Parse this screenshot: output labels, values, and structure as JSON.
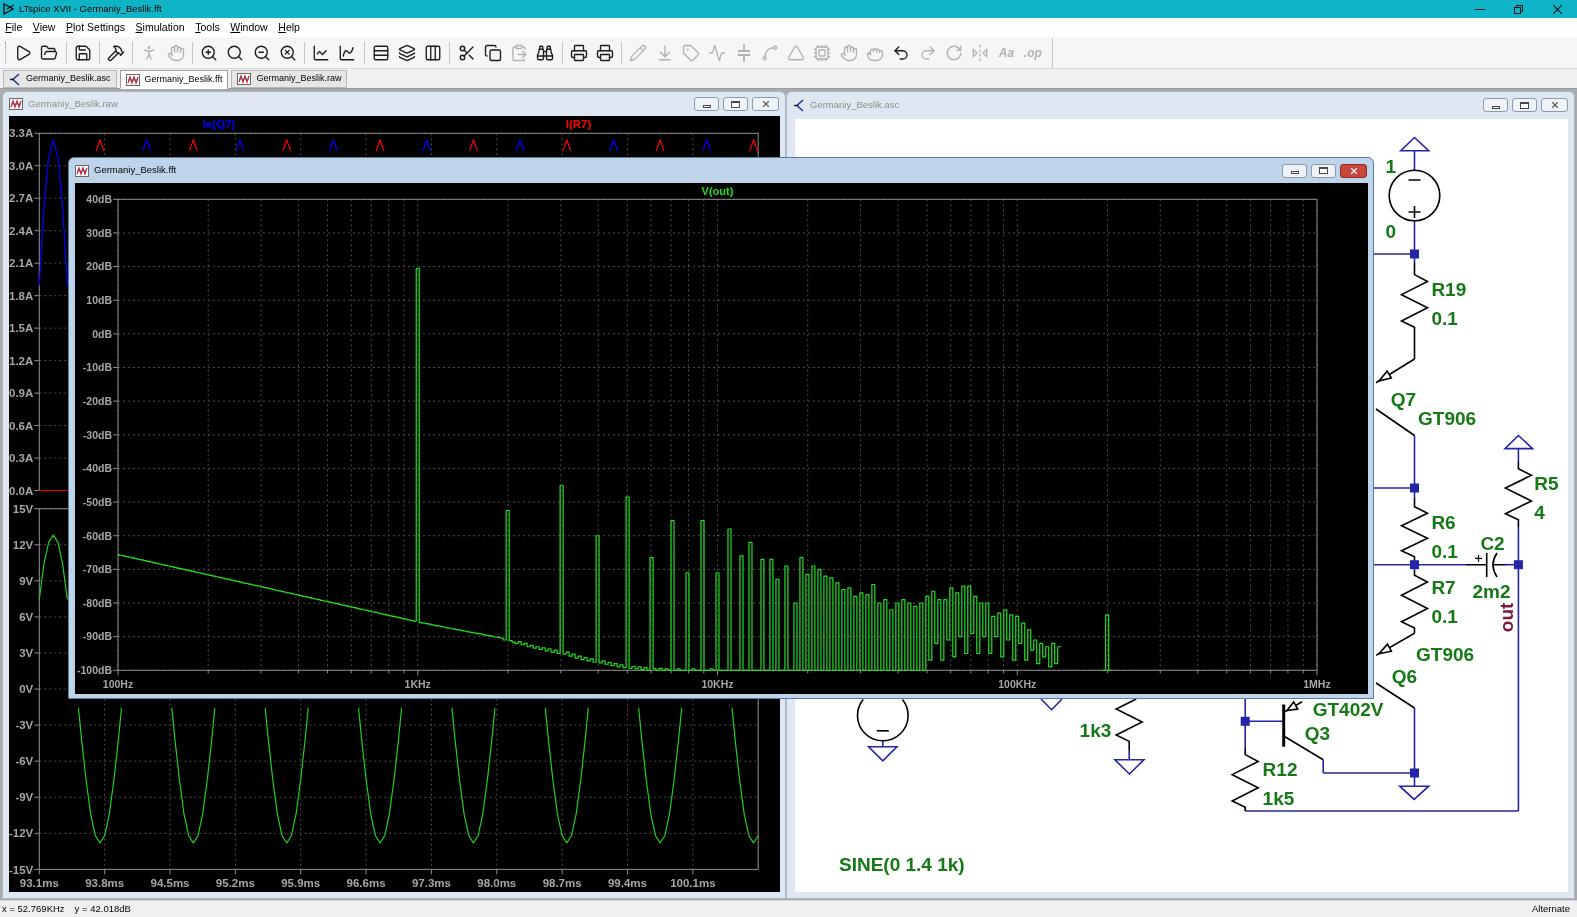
{
  "app": {
    "title": "LTspice XVII - Germaniy_Beslik.fft"
  },
  "menu": [
    "File",
    "View",
    "Plot Settings",
    "Simulation",
    "Tools",
    "Window",
    "Help"
  ],
  "toolbar": {
    "groups": [
      [
        {
          "disabled": false
        },
        {
          "disabled": false
        }
      ],
      [
        {
          "disabled": false
        }
      ],
      [
        {
          "disabled": false
        }
      ],
      [
        {
          "disabled": true
        },
        {
          "disabled": true
        }
      ],
      [
        {
          "disabled": false
        },
        {
          "disabled": false
        },
        {
          "disabled": false
        },
        {
          "disabled": false
        }
      ],
      [
        {
          "disabled": false
        },
        {
          "disabled": false
        }
      ],
      [
        {
          "disabled": false
        },
        {
          "disabled": false
        },
        {
          "disabled": false
        }
      ],
      [
        {
          "disabled": false
        },
        {
          "disabled": false
        },
        {
          "disabled": true
        },
        {
          "disabled": false
        }
      ],
      [
        {
          "disabled": false
        },
        {
          "disabled": false
        }
      ],
      [
        {
          "disabled": true
        },
        {
          "disabled": true
        },
        {
          "disabled": true
        },
        {
          "disabled": true
        },
        {
          "disabled": true
        },
        {
          "disabled": true
        },
        {
          "disabled": true
        },
        {
          "disabled": true
        },
        {
          "disabled": true
        },
        {
          "disabled": true
        },
        {
          "disabled": false
        },
        {
          "disabled": true
        },
        {
          "disabled": true
        },
        {
          "disabled": true
        },
        {
          "disabled": true,
          "label": "Aa"
        },
        {
          "disabled": true,
          "label": ".op"
        }
      ]
    ]
  },
  "tabs": [
    {
      "label": "Germaniy_Beslik.asc",
      "kind": "schematic",
      "selected": false
    },
    {
      "label": "Germaniy_Beslik.fft",
      "kind": "waveform",
      "selected": true
    },
    {
      "label": "Germaniy_Beslik.raw",
      "kind": "waveform",
      "selected": false
    }
  ],
  "raw_window": {
    "title": "Germaniy_Beslik.raw",
    "active": false,
    "panes": [
      {
        "chart_data": {
          "type": "line",
          "grid": true,
          "x": [
            93.1,
            93.15,
            93.2,
            93.25,
            93.3,
            93.35,
            93.4,
            93.5,
            93.71,
            93.75,
            93.79,
            94.0,
            94.21,
            94.25,
            94.29,
            94.5,
            94.71,
            94.75,
            94.79,
            95.0,
            95.21,
            95.25,
            95.29,
            95.5,
            95.71,
            95.75,
            95.79,
            96.0,
            96.21,
            96.25,
            96.29,
            96.5,
            96.71,
            96.75,
            96.79,
            97.0,
            97.21,
            97.25,
            97.29,
            97.5,
            97.71,
            97.75,
            97.79,
            98.0,
            98.21,
            98.25,
            98.29,
            98.5,
            98.71,
            98.75,
            98.79,
            99.0,
            99.21,
            99.25,
            99.29,
            99.5,
            99.71,
            99.75,
            99.79,
            100.0,
            100.21,
            100.25,
            100.29,
            100.5,
            100.71,
            100.75,
            100.79
          ],
          "xlim": [
            93.1,
            100.8
          ],
          "ylim": [
            0,
            3.3
          ],
          "yticks": [
            {
              "value": 0,
              "label": "0.0A"
            },
            {
              "value": 0.3,
              "label": "0.3A"
            },
            {
              "value": 0.6,
              "label": "0.6A"
            },
            {
              "value": 0.9,
              "label": "0.9A"
            },
            {
              "value": 1.2,
              "label": "1.2A"
            },
            {
              "value": 1.5,
              "label": "1.5A"
            },
            {
              "value": 1.8,
              "label": "1.8A"
            },
            {
              "value": 2.1,
              "label": "2.1A"
            },
            {
              "value": 2.4,
              "label": "2.4A"
            },
            {
              "value": 2.7,
              "label": "2.7A"
            },
            {
              "value": 3.0,
              "label": "3.0A"
            },
            {
              "value": 3.3,
              "label": "3.3A"
            }
          ],
          "series": [
            {
              "name": "Ie(Q7)",
              "color": "#0000ff",
              "values": [
                1.9,
                2.62,
                3.08,
                3.24,
                3.08,
                2.62,
                1.9,
                null,
                null,
                null,
                null,
                null,
                3.14,
                3.24,
                3.14,
                null,
                null,
                null,
                null,
                null,
                3.14,
                3.24,
                3.14,
                null,
                null,
                null,
                null,
                null,
                3.14,
                3.24,
                3.14,
                null,
                null,
                null,
                null,
                null,
                3.14,
                3.24,
                3.14,
                null,
                null,
                null,
                null,
                null,
                3.14,
                3.24,
                3.14,
                null,
                null,
                null,
                null,
                null,
                3.14,
                3.24,
                3.14,
                null,
                null,
                null,
                null,
                null,
                3.14,
                3.24,
                3.14,
                null,
                null,
                null,
                null
              ]
            },
            {
              "name": "I(R7)",
              "color": "#ff0000",
              "values": [
                0,
                0,
                0,
                0,
                0,
                0,
                0,
                null,
                3.14,
                3.24,
                3.14,
                null,
                null,
                null,
                null,
                null,
                3.14,
                3.24,
                3.14,
                null,
                null,
                null,
                null,
                null,
                3.14,
                3.24,
                3.14,
                null,
                null,
                null,
                null,
                null,
                3.14,
                3.24,
                3.14,
                null,
                null,
                null,
                null,
                null,
                3.14,
                3.24,
                3.14,
                null,
                null,
                null,
                null,
                null,
                3.14,
                3.24,
                3.14,
                null,
                null,
                null,
                null,
                null,
                3.14,
                3.24,
                3.14,
                null,
                null,
                null,
                null,
                null,
                3.14,
                3.24,
                3.14
              ]
            }
          ]
        }
      },
      {
        "chart_data": {
          "type": "line",
          "grid": true,
          "x": [
            93.1,
            93.15,
            93.2,
            93.25,
            93.3,
            93.35,
            93.4,
            93.46,
            93.52,
            93.55,
            93.6,
            93.65,
            93.7,
            93.75,
            93.8,
            93.85,
            93.9,
            93.95,
            93.98,
            94.4,
            94.52,
            94.55,
            94.6,
            94.65,
            94.7,
            94.75,
            94.8,
            94.85,
            94.9,
            94.95,
            94.98,
            95.4,
            95.52,
            95.55,
            95.6,
            95.65,
            95.7,
            95.75,
            95.8,
            95.85,
            95.9,
            95.95,
            95.98,
            96.4,
            96.52,
            96.55,
            96.6,
            96.65,
            96.7,
            96.75,
            96.8,
            96.85,
            96.9,
            96.95,
            96.98,
            97.4,
            97.52,
            97.55,
            97.6,
            97.65,
            97.7,
            97.75,
            97.8,
            97.85,
            97.9,
            97.95,
            97.98,
            98.4,
            98.52,
            98.55,
            98.6,
            98.65,
            98.7,
            98.75,
            98.8,
            98.85,
            98.9,
            98.95,
            98.98,
            99.4,
            99.52,
            99.55,
            99.6,
            99.65,
            99.7,
            99.75,
            99.8,
            99.85,
            99.9,
            99.95,
            99.98,
            100.4,
            100.52,
            100.55,
            100.6,
            100.65,
            100.7,
            100.75,
            100.8
          ],
          "xlim": [
            93.1,
            100.8
          ],
          "ylim": [
            -15,
            15
          ],
          "xticks": [
            {
              "value": 93.1,
              "label": "93.1ms"
            },
            {
              "value": 93.8,
              "label": "93.8ms"
            },
            {
              "value": 94.5,
              "label": "94.5ms"
            },
            {
              "value": 95.2,
              "label": "95.2ms"
            },
            {
              "value": 95.9,
              "label": "95.9ms"
            },
            {
              "value": 96.6,
              "label": "96.6ms"
            },
            {
              "value": 97.3,
              "label": "97.3ms"
            },
            {
              "value": 98.0,
              "label": "98.0ms"
            },
            {
              "value": 98.7,
              "label": "98.7ms"
            },
            {
              "value": 99.4,
              "label": "99.4ms"
            },
            {
              "value": 100.1,
              "label": "100.1ms"
            }
          ],
          "yticks": [
            {
              "value": -15,
              "label": "-15V"
            },
            {
              "value": -12,
              "label": "-12V"
            },
            {
              "value": -9,
              "label": "-9V"
            },
            {
              "value": -6,
              "label": "-6V"
            },
            {
              "value": -3,
              "label": "-3V"
            },
            {
              "value": 0,
              "label": "0V"
            },
            {
              "value": 3,
              "label": "3V"
            },
            {
              "value": 6,
              "label": "6V"
            },
            {
              "value": 9,
              "label": "9V"
            },
            {
              "value": 12,
              "label": "12V"
            },
            {
              "value": 15,
              "label": "15V"
            }
          ],
          "series": [
            {
              "color": "#22cc22",
              "values": [
                7.5,
                10.4,
                12.2,
                12.8,
                12.2,
                10.4,
                7.5,
                null,
                -1.6,
                -4,
                -7.5,
                -10.4,
                -12.2,
                -12.8,
                -12.2,
                -10.4,
                -7.5,
                -4,
                -1.6,
                null,
                -1.6,
                -4,
                -7.5,
                -10.4,
                -12.2,
                -12.8,
                -12.2,
                -10.4,
                -7.5,
                -4,
                -1.6,
                null,
                -1.6,
                -4,
                -7.5,
                -10.4,
                -12.2,
                -12.8,
                -12.2,
                -10.4,
                -7.5,
                -4,
                -1.6,
                null,
                -1.6,
                -4,
                -7.5,
                -10.4,
                -12.2,
                -12.8,
                -12.2,
                -10.4,
                -7.5,
                -4,
                -1.6,
                null,
                -1.6,
                -4,
                -7.5,
                -10.4,
                -12.2,
                -12.8,
                -12.2,
                -10.4,
                -7.5,
                -4,
                -1.6,
                null,
                -1.6,
                -4,
                -7.5,
                -10.4,
                -12.2,
                -12.8,
                -12.2,
                -10.4,
                -7.5,
                -4,
                -1.6,
                null,
                -1.6,
                -4,
                -7.5,
                -10.4,
                -12.2,
                -12.8,
                -12.2,
                -10.4,
                -7.5,
                -4,
                -1.6,
                null,
                -1.6,
                -4,
                -7.5,
                -10.4,
                -12.2,
                -12.8,
                -12.2
              ]
            }
          ]
        }
      }
    ]
  },
  "schematic_window": {
    "title": "Germaniy_Beslik.asc",
    "active": false,
    "labels": [
      {
        "text": "1",
        "kind": "part"
      },
      {
        "text": "0",
        "kind": "part"
      },
      {
        "text": "R19",
        "kind": "part"
      },
      {
        "text": "0.1",
        "kind": "part"
      },
      {
        "text": "Q7",
        "kind": "part"
      },
      {
        "text": "GT906",
        "kind": "part"
      },
      {
        "text": "R5",
        "kind": "part"
      },
      {
        "text": "4",
        "kind": "part"
      },
      {
        "text": "R6",
        "kind": "part"
      },
      {
        "text": "C2",
        "kind": "part"
      },
      {
        "text": "0.1",
        "kind": "part"
      },
      {
        "text": "R7",
        "kind": "part"
      },
      {
        "text": "2m2",
        "kind": "part"
      },
      {
        "text": "out",
        "kind": "net"
      },
      {
        "text": "0.1",
        "kind": "part"
      },
      {
        "text": "GT906",
        "kind": "part"
      },
      {
        "text": "Q6",
        "kind": "part"
      },
      {
        "text": "GT402V",
        "kind": "part"
      },
      {
        "text": "1k3",
        "kind": "part"
      },
      {
        "text": "Q3",
        "kind": "part"
      },
      {
        "text": "R12",
        "kind": "part"
      },
      {
        "text": "1k5",
        "kind": "part"
      },
      {
        "text": "SINE(0 1.4 1k)",
        "kind": "part"
      }
    ]
  },
  "fft_window": {
    "title": "Germaniy_Beslik.fft",
    "active": true,
    "chart_data": {
      "type": "line",
      "grid": true,
      "categories": [
        "100Hz",
        null,
        null,
        null,
        null,
        null,
        null,
        null,
        null,
        null,
        null,
        null,
        null,
        null,
        null,
        null,
        null,
        null,
        null,
        null,
        null,
        null,
        null,
        null,
        null,
        null,
        null,
        null,
        null,
        null,
        null,
        null,
        null,
        null,
        null,
        null,
        null,
        null,
        null,
        null,
        null,
        null,
        null,
        null,
        null,
        null,
        null,
        null,
        null,
        null,
        null,
        null,
        null,
        null,
        null,
        null,
        null,
        null,
        null,
        null,
        null,
        null,
        null,
        null,
        null,
        null,
        null,
        null,
        null,
        null,
        null,
        null,
        null,
        null,
        null,
        null,
        null,
        null,
        null,
        null,
        null,
        null,
        null,
        null,
        null,
        null,
        null,
        null,
        null,
        null,
        null,
        null,
        null,
        null,
        null,
        null,
        null,
        null,
        null,
        null,
        "1KHz",
        null,
        null,
        null,
        null,
        null,
        null,
        null,
        null,
        null,
        null,
        null,
        null,
        null,
        null,
        null,
        null,
        null,
        null,
        null,
        null,
        null,
        null,
        null,
        null,
        null,
        null,
        null,
        null,
        null,
        null,
        null,
        null,
        null,
        null,
        null,
        null,
        null,
        null,
        null,
        null,
        null,
        null,
        null,
        null,
        null,
        null,
        null,
        null,
        null,
        null,
        null,
        null,
        null,
        null,
        null,
        null,
        null,
        null,
        null,
        null,
        null,
        null,
        null,
        null,
        null,
        null,
        null,
        null,
        null,
        null,
        null,
        null,
        null,
        null,
        null,
        null,
        null,
        null,
        null,
        null,
        null,
        null,
        null,
        null,
        null,
        null,
        null,
        null,
        null,
        null,
        null,
        null,
        null,
        null,
        null,
        null,
        null,
        null,
        null,
        "10KHz",
        null,
        null,
        null,
        null,
        null,
        null,
        null,
        null,
        null,
        null,
        null,
        null,
        null,
        null,
        null,
        null,
        null,
        null,
        null,
        null,
        null,
        null,
        null,
        null,
        null,
        null,
        null,
        null,
        null,
        null,
        null,
        null,
        null,
        null,
        null,
        null,
        null,
        null,
        null,
        null,
        null,
        null,
        null,
        null,
        null,
        null,
        null,
        null,
        null,
        null,
        null,
        null,
        null,
        null,
        null,
        null,
        null,
        null,
        null,
        null,
        null,
        null,
        null,
        null,
        null,
        null,
        null,
        null,
        null,
        null,
        null,
        null,
        null,
        null,
        null,
        null,
        null,
        null,
        null,
        null,
        null,
        null,
        null,
        null,
        null,
        null,
        null,
        null,
        null,
        null,
        null,
        null,
        null,
        null,
        null,
        null,
        null,
        null,
        null,
        "100KHz",
        null,
        null,
        null,
        null,
        null,
        null,
        null,
        null,
        null,
        null,
        null,
        null,
        null,
        null,
        null,
        null,
        null,
        null,
        null,
        null,
        null,
        null,
        null,
        null,
        null,
        null,
        null,
        null,
        null,
        null,
        null,
        null,
        null,
        null,
        null,
        null,
        null,
        null,
        null,
        null,
        null,
        null,
        null,
        null,
        null,
        null,
        null,
        null,
        null,
        null,
        null,
        null,
        null,
        null,
        null,
        null,
        null,
        null,
        null,
        null,
        null,
        null,
        null,
        null,
        null,
        null,
        null,
        null,
        null,
        null,
        null,
        null,
        null,
        null,
        null,
        null,
        null,
        null,
        null,
        null,
        null,
        null,
        null,
        null,
        null,
        null,
        null,
        null,
        null,
        null,
        null,
        null,
        null,
        null,
        null,
        null,
        null,
        null,
        null,
        "1MHz"
      ],
      "ylim": [
        -100,
        40
      ],
      "yticks": [
        {
          "value": -100,
          "label": "-100dB"
        },
        {
          "value": -90,
          "label": "-90dB"
        },
        {
          "value": -80,
          "label": "-80dB"
        },
        {
          "value": -70,
          "label": "-70dB"
        },
        {
          "value": -60,
          "label": "-60dB"
        },
        {
          "value": -50,
          "label": "-50dB"
        },
        {
          "value": -40,
          "label": "-40dB"
        },
        {
          "value": -30,
          "label": "-30dB"
        },
        {
          "value": -20,
          "label": "-20dB"
        },
        {
          "value": -10,
          "label": "-10dB"
        },
        {
          "value": 0,
          "label": "0dB"
        },
        {
          "value": 10,
          "label": "10dB"
        },
        {
          "value": 20,
          "label": "20dB"
        },
        {
          "value": 30,
          "label": "30dB"
        },
        {
          "value": 40,
          "label": "40dB"
        }
      ],
      "series": [
        {
          "name": "V(out)",
          "color": "#22dd22",
          "values": [
            -65.6,
            -65.8,
            -66,
            -66.2,
            -66.4,
            -66.6,
            -66.8,
            -67,
            -67.2,
            -67.4,
            -67.6,
            -67.8,
            -68,
            -68.2,
            -68.4,
            -68.6,
            -68.8,
            -69,
            -69.2,
            -69.4,
            -69.6,
            -69.8,
            -70,
            -70.2,
            -70.4,
            -70.6,
            -70.8,
            -71,
            -71.2,
            -71.4,
            -71.6,
            -71.8,
            -72,
            -72.2,
            -72.4,
            -72.6,
            -72.8,
            -73,
            -73.2,
            -73.4,
            -73.6,
            -73.8,
            -74,
            -74.2,
            -74.4,
            -74.6,
            -74.8,
            -75,
            -75.2,
            -75.4,
            -75.6,
            -75.8,
            -76,
            -76.2,
            -76.4,
            -76.6,
            -76.8,
            -77,
            -77.2,
            -77.4,
            -77.6,
            -77.8,
            -78,
            -78.2,
            -78.4,
            -78.6,
            -78.8,
            -79,
            -79.2,
            -79.4,
            -79.6,
            -79.8,
            -80,
            -80.2,
            -80.4,
            -80.6,
            -80.8,
            -81,
            -81.2,
            -81.4,
            -81.6,
            -81.8,
            -82,
            -82.2,
            -82.4,
            -82.6,
            -82.8,
            -83,
            -83.2,
            -83.4,
            -83.6,
            -83.8,
            -84,
            -84.2,
            -84.4,
            -84.6,
            -84.8,
            -85,
            -85.2,
            -85.4,
            19.5,
            -85.8,
            -86,
            -86.1,
            -86.3,
            -86.5,
            -86.7,
            -86.8,
            -87,
            -87.2,
            -87.4,
            -87.5,
            -87.7,
            -87.9,
            -88,
            -88.2,
            -88.4,
            -88.6,
            -88.7,
            -88.9,
            -89.1,
            -89.2,
            -89.4,
            -89.6,
            -89.7,
            -89.9,
            -90.1,
            -90.2,
            -90.4,
            -91,
            -52.5,
            -91.2,
            -91.6,
            -92,
            -91.5,
            -92.4,
            -92,
            -93,
            -92.6,
            -93.4,
            -93,
            -93.8,
            -93.3,
            -94.2,
            -93.6,
            -94.6,
            -94,
            -95,
            -45,
            -95.2,
            -94.6,
            -95.8,
            -95.2,
            -96.4,
            -95.8,
            -96.8,
            -96.2,
            -97.2,
            -96.6,
            -97.6,
            -60,
            -97.8,
            -97.2,
            -98.2,
            -97.6,
            -98.6,
            -98,
            -99,
            -98.4,
            -99.2,
            -48.5,
            -99.4,
            -98.8,
            -99.6,
            -99,
            -99.8,
            -99.2,
            -100,
            -66.5,
            -99.5,
            -100,
            -99.4,
            -100,
            -99.6,
            -100,
            -55.5,
            -100,
            -99.6,
            -100,
            -100,
            -71,
            -100,
            -99.6,
            -100,
            -100,
            -55.5,
            -100,
            -100,
            -99.6,
            -100,
            -71,
            -100,
            -100,
            -100,
            -58,
            -100,
            -100,
            -100,
            -66,
            -100,
            -100,
            -62,
            -100,
            -100,
            -100,
            -67,
            -100,
            -100,
            -67,
            -100,
            -73,
            -100,
            -100,
            -69,
            -100,
            -100,
            -80,
            -100,
            -66.5,
            -100,
            -71.5,
            -100,
            -69,
            -100,
            -70,
            -100,
            -72,
            -100,
            -72.5,
            -100,
            -74,
            -100,
            -76,
            -100,
            -75.5,
            -100,
            -78,
            -100,
            -77,
            -100,
            -77.5,
            -100,
            -74.5,
            -100,
            -80,
            -100,
            -79,
            -100,
            -82,
            -100,
            -80,
            -100,
            -79,
            -100,
            -80,
            -100,
            -81,
            -100,
            -80,
            -100,
            -78,
            -97,
            -76.5,
            -92,
            -79,
            -97,
            -79,
            -91,
            -75.5,
            -96,
            -77,
            -90,
            -75,
            -95,
            -75,
            -89,
            -78,
            -95,
            -80,
            -90,
            -80,
            -95,
            -84,
            -90,
            -83,
            -96,
            -82,
            -91,
            -83.5,
            -97,
            -84,
            -92,
            -86,
            -97,
            -88,
            -94,
            -91,
            -98,
            -92,
            -96,
            -93,
            -99,
            -92,
            -98,
            -93,
            null,
            null,
            null,
            null,
            null,
            null,
            null,
            null,
            null,
            null,
            null,
            null,
            null,
            null,
            -100,
            -83.5,
            -100,
            null,
            null,
            null,
            null,
            null,
            null,
            null,
            null,
            null,
            null,
            null,
            null,
            null,
            null,
            null,
            null,
            null,
            null,
            null,
            null,
            null,
            null,
            null,
            null,
            null,
            null,
            null,
            null,
            null,
            null,
            null,
            null,
            null,
            null,
            null,
            null,
            null,
            null,
            null,
            null,
            null,
            null,
            null,
            null,
            null,
            null,
            null,
            null,
            null,
            null,
            null,
            null,
            null,
            null,
            null,
            null,
            null,
            null,
            null,
            null,
            null,
            null,
            null,
            null,
            null,
            null,
            null,
            null,
            null
          ]
        }
      ]
    }
  },
  "status_bar": {
    "cursor_x": "x = 52.769KHz",
    "cursor_y": "y = 42.018dB",
    "mode": "Alternate"
  }
}
